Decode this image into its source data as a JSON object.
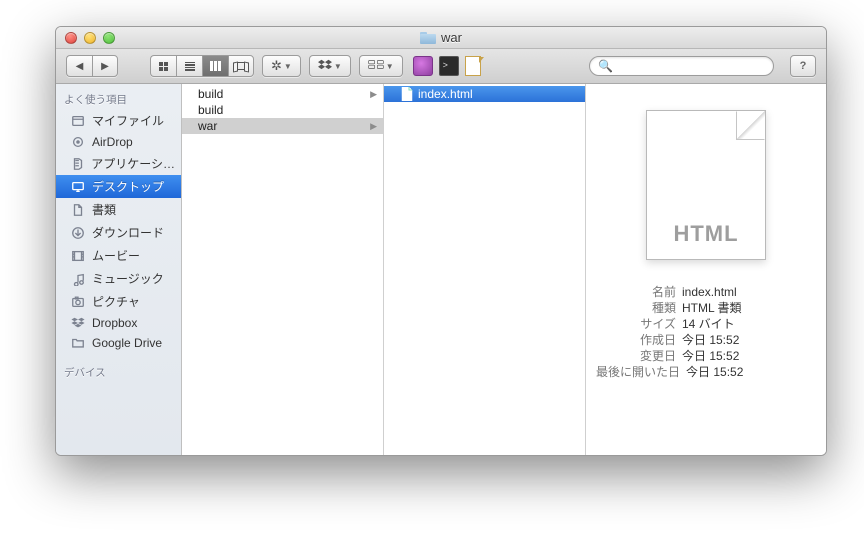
{
  "window": {
    "title": "war"
  },
  "sidebar": {
    "headers": {
      "favorites": "よく使う項目",
      "devices": "デバイス"
    },
    "items": [
      {
        "icon": "myfiles",
        "label": "マイファイル"
      },
      {
        "icon": "airdrop",
        "label": "AirDrop"
      },
      {
        "icon": "apps",
        "label": "アプリケーシ…"
      },
      {
        "icon": "desktop",
        "label": "デスクトップ",
        "selected": true
      },
      {
        "icon": "documents",
        "label": "書類"
      },
      {
        "icon": "downloads",
        "label": "ダウンロード"
      },
      {
        "icon": "movies",
        "label": "ムービー"
      },
      {
        "icon": "music",
        "label": "ミュージック"
      },
      {
        "icon": "pictures",
        "label": "ピクチャ"
      },
      {
        "icon": "dropbox",
        "label": "Dropbox"
      },
      {
        "icon": "gdrive",
        "label": "Google Drive"
      }
    ]
  },
  "columns": {
    "col1": [
      {
        "label": "build",
        "arrow": true
      },
      {
        "label": "build",
        "arrow": false
      },
      {
        "label": "war",
        "arrow": true,
        "selected": true
      }
    ],
    "col2": [
      {
        "label": "index.html",
        "selected": true
      }
    ]
  },
  "preview": {
    "thumb_label": "HTML",
    "meta": [
      {
        "k": "名前",
        "v": "index.html"
      },
      {
        "k": "種類",
        "v": "HTML 書類"
      },
      {
        "k": "サイズ",
        "v": "14 バイト"
      },
      {
        "k": "作成日",
        "v": "今日 15:52"
      },
      {
        "k": "変更日",
        "v": "今日 15:52"
      },
      {
        "k": "最後に開いた日",
        "v": "今日 15:52"
      }
    ]
  },
  "search": {
    "placeholder": ""
  }
}
